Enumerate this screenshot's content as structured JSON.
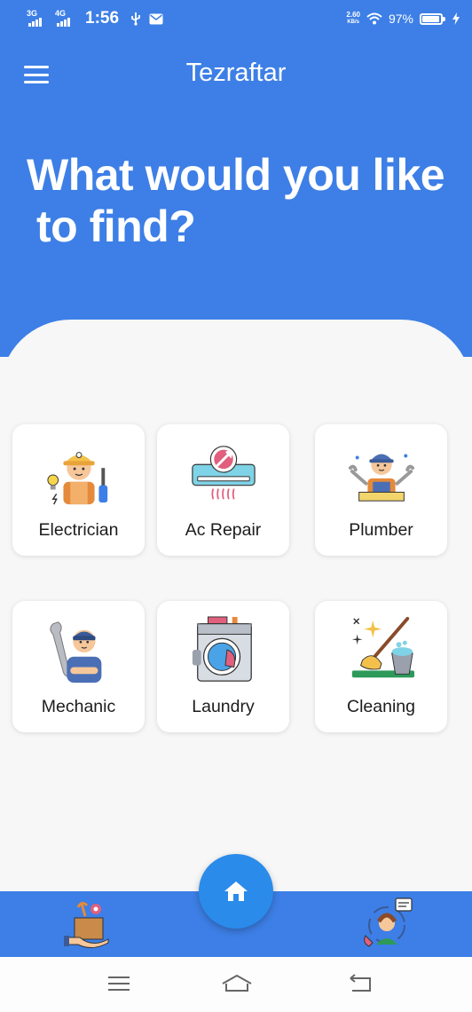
{
  "status_bar": {
    "network_1": "3G",
    "network_2": "4G",
    "time": "1:56",
    "speed_value": "2.60",
    "speed_unit": "KB/s",
    "battery": "97%"
  },
  "header": {
    "title": "Tezraftar",
    "hero_line1": "What would you like",
    "hero_line2": "to find?"
  },
  "services": [
    {
      "label": "Electrician",
      "icon": "electrician-icon"
    },
    {
      "label": "Ac Repair",
      "icon": "ac-repair-icon"
    },
    {
      "label": "Plumber",
      "icon": "plumber-icon"
    },
    {
      "label": "Mechanic",
      "icon": "mechanic-icon"
    },
    {
      "label": "Laundry",
      "icon": "laundry-icon"
    },
    {
      "label": "Cleaning",
      "icon": "cleaning-icon"
    }
  ],
  "bottom_nav": {
    "left_icon": "service-box-icon",
    "center_icon": "home-icon",
    "right_icon": "support-agent-icon"
  },
  "colors": {
    "primary": "#3d7fe6",
    "fab": "#2a8bea",
    "background": "#f7f7f7"
  }
}
